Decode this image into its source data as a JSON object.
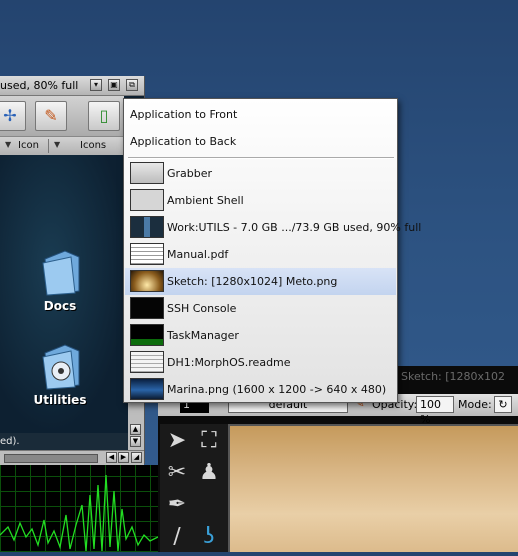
{
  "drawer_window": {
    "title": "used, 80% full",
    "view_options": [
      "Icon",
      "Icons"
    ],
    "icons": [
      {
        "label": "Docs",
        "icon": "folder-icon"
      },
      {
        "label": "Utilities",
        "icon": "utilities-folder-icon"
      }
    ],
    "status_text": "ed)."
  },
  "popup_menu": {
    "actions": [
      {
        "label": "Application to Front"
      },
      {
        "label": "Application to Back"
      }
    ],
    "windows": [
      {
        "label": "Grabber",
        "thumb": "grabber-thumbnail",
        "selected": false
      },
      {
        "label": "Ambient Shell",
        "thumb": "shell-thumbnail",
        "selected": false
      },
      {
        "label": "Work:UTILS - 7.0 GB .../73.9 GB used, 90% full",
        "thumb": "drawer-thumbnail",
        "selected": false
      },
      {
        "label": "Manual.pdf",
        "thumb": "pdf-thumbnail",
        "selected": false
      },
      {
        "label": "Sketch: [1280x1024] Meto.png",
        "thumb": "sketch-thumbnail",
        "selected": true
      },
      {
        "label": "SSH Console",
        "thumb": "console-thumbnail",
        "selected": false
      },
      {
        "label": "TaskManager",
        "thumb": "taskmanager-thumbnail",
        "selected": false
      },
      {
        "label": "DH1:MorphOS.readme",
        "thumb": "readme-thumbnail",
        "selected": false
      },
      {
        "label": "Marina.png (1600 x 1200 -> 640 x 480)",
        "thumb": "image-thumbnail",
        "selected": false
      }
    ]
  },
  "sketch_window": {
    "title": "Sketch: [1280x102",
    "brush_number": "1",
    "preset": "default",
    "opacity_label": "Opacity:",
    "opacity_value": "100 %",
    "mode_label": "Mode:"
  },
  "colors": {
    "desktop": "#2d5382",
    "menu_selected": "#c3d4ef",
    "graph_line": "#22dd22"
  }
}
